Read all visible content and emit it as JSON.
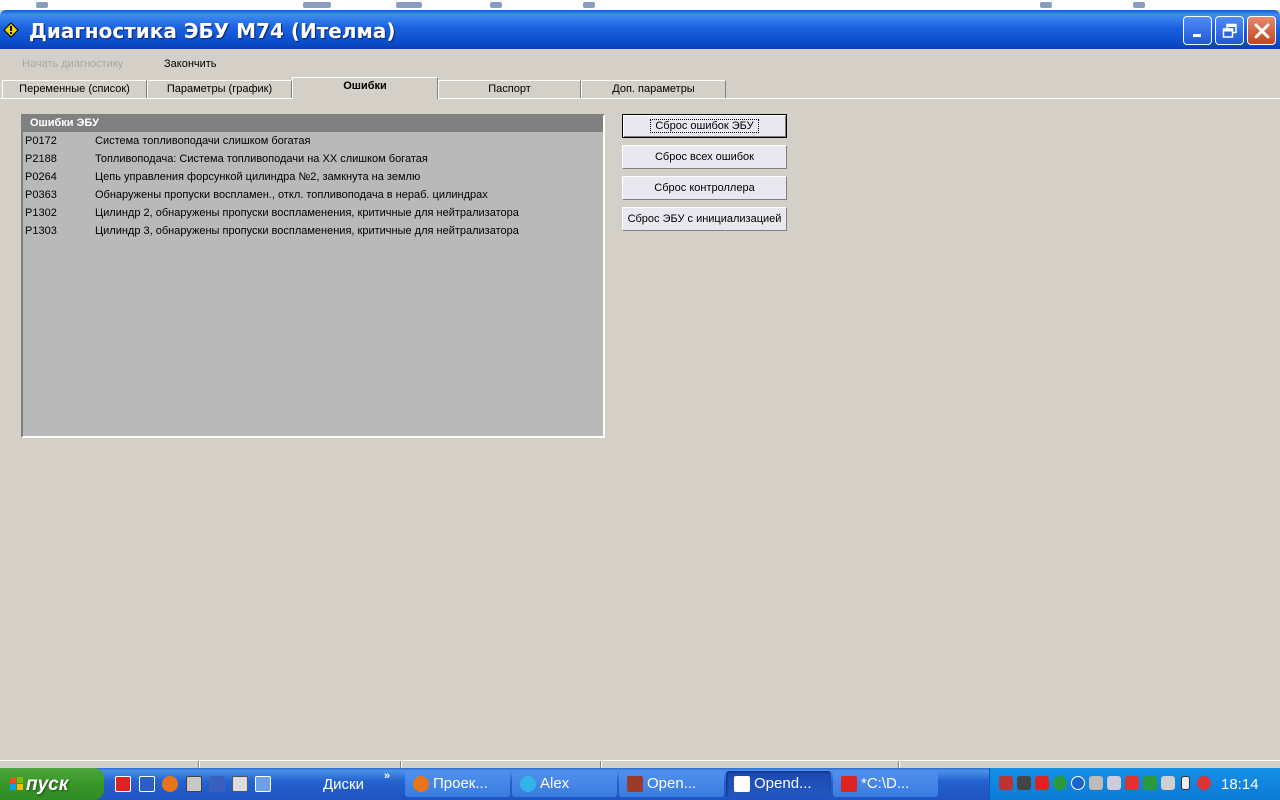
{
  "window": {
    "title": "Диагностика ЭБУ М74 (Ителма)"
  },
  "menu": {
    "start_label": "Начать диагностику",
    "finish_label": "Закончить"
  },
  "tabs": [
    {
      "label": "Переменные (список)"
    },
    {
      "label": "Параметры (график)"
    },
    {
      "label": "Ошибки"
    },
    {
      "label": "Паспорт"
    },
    {
      "label": "Доп. параметры"
    }
  ],
  "errors_panel": {
    "header": "Ошибки ЭБУ",
    "rows": [
      {
        "code": "P0172",
        "desc": "Система топливоподачи слишком богатая"
      },
      {
        "code": "P2188",
        "desc": "Топливоподача: Система топливоподачи на XX слишком богатая"
      },
      {
        "code": "P0264",
        "desc": "Цепь управления форсункой цилиндра №2, замкнута на землю"
      },
      {
        "code": "P0363",
        "desc": "Обнаружены пропуски воспламен., откл. топливоподача в нераб. цилиндрах"
      },
      {
        "code": "P1302",
        "desc": "Цилиндр 2, обнаружены пропуски воспламенения, критичные для нейтрализатора"
      },
      {
        "code": "P1303",
        "desc": "Цилиндр 3, обнаружены пропуски воспламенения, критичные для нейтрализатора"
      }
    ]
  },
  "buttons": {
    "reset_ecu": "Сброс ошибок ЭБУ",
    "reset_all": "Сброс всех ошибок",
    "reset_controller": "Сброс контроллера",
    "reset_init": "Сброс ЭБУ с инициализацией"
  },
  "taskbar": {
    "start": "пуск",
    "folder": "Диски",
    "chevron": "»",
    "tasks": [
      {
        "label": "Проек..."
      },
      {
        "label": "Alex"
      },
      {
        "label": "Open..."
      },
      {
        "label": "Opend..."
      },
      {
        "label": "*C:\\D..."
      }
    ],
    "clock": "18:14"
  },
  "colors": {
    "title_bar": "#0a4ccb",
    "window_bg": "#d4d0c8",
    "panel_bg": "#b9b9b9",
    "panel_header": "#808080",
    "start_green": "#3c9a2b",
    "taskbar_blue": "#2563d0"
  },
  "icons": {
    "app": "diamond-warning-icon",
    "minimize": "minimize-icon",
    "maximize": "restore-icon",
    "close": "close-icon"
  }
}
